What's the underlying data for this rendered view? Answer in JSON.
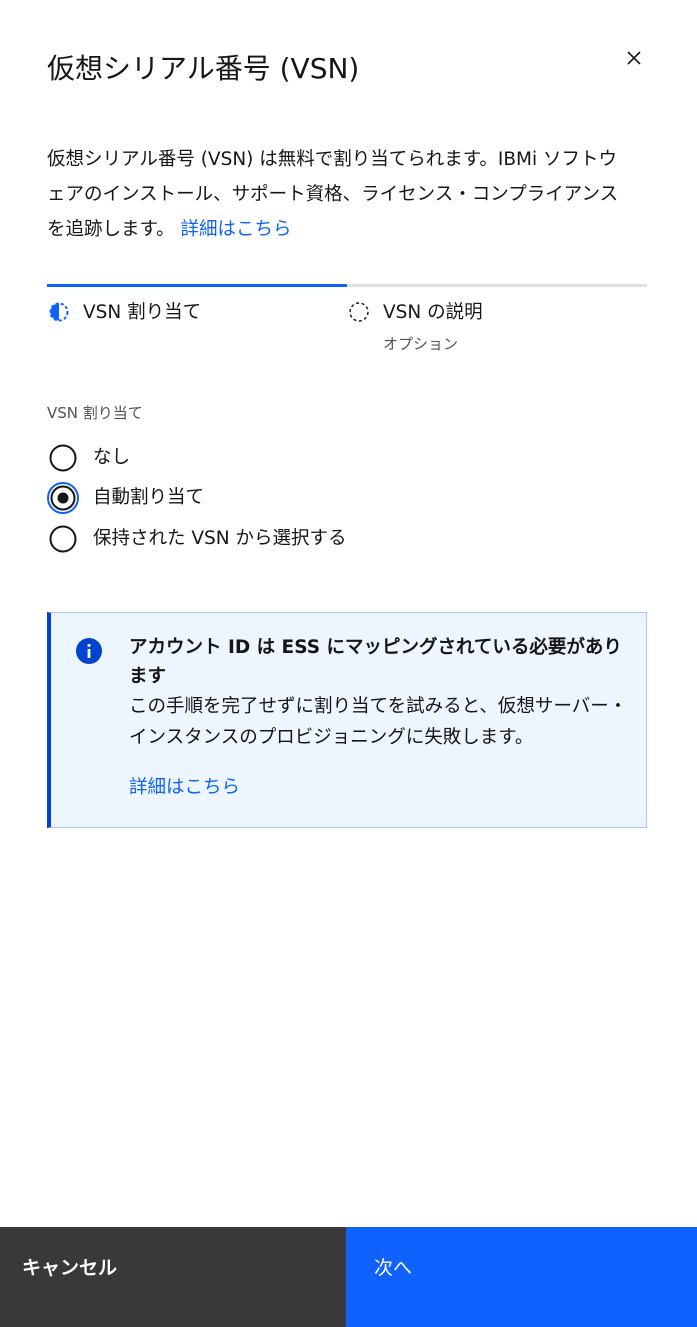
{
  "modal": {
    "title": "仮想シリアル番号 (VSN)",
    "description": "仮想シリアル番号 (VSN) は無料で割り当てられます。IBMi ソフトウェアのインストール、サポート資格、ライセンス・コンプライアンスを追跡します。",
    "description_link": "詳細はこちら"
  },
  "progress": {
    "steps": [
      {
        "label": "VSN 割り当て",
        "sub": "",
        "state": "current"
      },
      {
        "label": "VSN の説明",
        "sub": "オプション",
        "state": "incomplete"
      }
    ]
  },
  "form": {
    "group_label": "VSN 割り当て",
    "options": [
      {
        "label": "なし",
        "checked": false
      },
      {
        "label": "自動割り当て",
        "checked": true
      },
      {
        "label": "保持された VSN から選択する",
        "checked": false
      }
    ]
  },
  "notification": {
    "title": "アカウント ID は ESS にマッピングされている必要があります",
    "body": "この手順を完了せずに割り当てを試みると、仮想サーバー・インスタンスのプロビジョニングに失敗します。",
    "link": "詳細はこちら"
  },
  "footer": {
    "cancel_label": "キャンセル",
    "next_label": "次へ"
  },
  "colors": {
    "primary": "#0f62fe",
    "info_bg": "#edf5ff",
    "info_border": "#0043ce",
    "cancel_bg": "#393939"
  },
  "icons": {
    "close": "close-icon",
    "step_current": "half-circle-icon",
    "step_incomplete": "dashed-circle-icon",
    "info": "info-icon"
  }
}
